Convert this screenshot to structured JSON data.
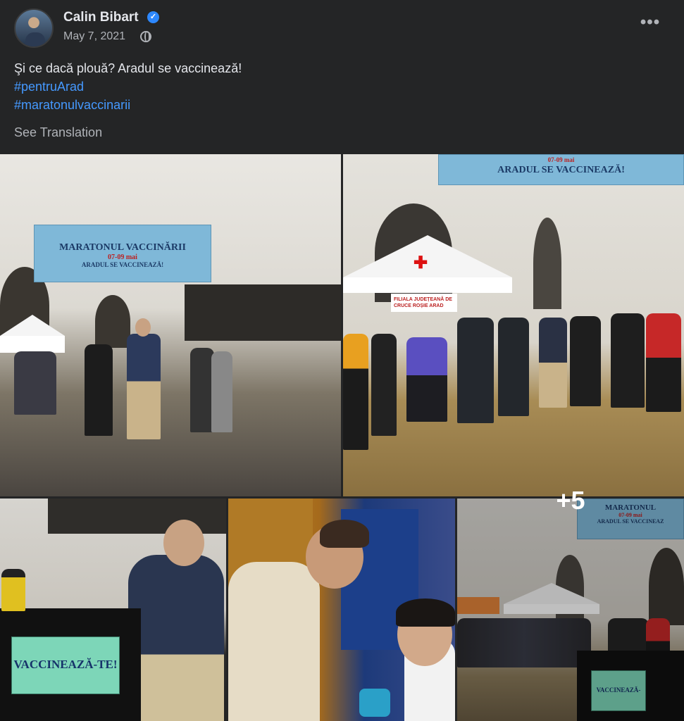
{
  "post": {
    "author": "Calin Bibart",
    "date": "May 7, 2021",
    "text": "Şi ce dacă plouă? Aradul se vaccinează!",
    "hashtags": [
      "#pentruArad",
      "#maratonulvaccinarii"
    ],
    "see_translation": "See Translation",
    "more_menu": "•••"
  },
  "photos": {
    "banner_1_line1": "MARATONUL VACCINĂRII",
    "banner_1_line2": "07-09 mai",
    "banner_1_line3": "ARADUL SE VACCINEAZĂ!",
    "banner_2_line1": "07-09 mai",
    "banner_2_line2": "ARADUL SE VACCINEAZĂ!",
    "tent_sign": "FILIALA JUDEȚEANĂ DE CRUCE ROȘIE ARAD",
    "sign_vaccineaza": "VACCINEAZĂ-TE!",
    "banner_3_line1": "MARATONUL",
    "banner_3_line2": "07-09 mai",
    "banner_3_line3": "ARADUL SE VACCINEAZ",
    "sign_small": "VACCINEAZĂ-TE!",
    "more_count": "+5"
  },
  "icons": {
    "verified": "verified-badge-icon",
    "privacy": "globe-icon",
    "menu": "more-options-icon"
  },
  "colors": {
    "background": "#242526",
    "text": "#e4e6eb",
    "secondary_text": "#b0b3b8",
    "link": "#4599ff",
    "verified": "#2d88ff"
  }
}
